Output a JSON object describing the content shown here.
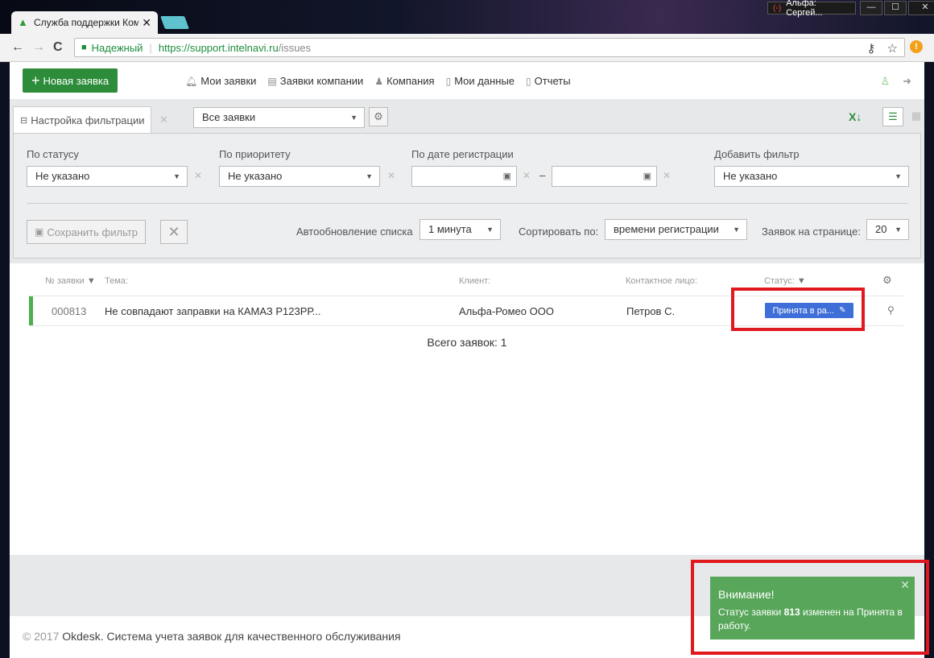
{
  "browser": {
    "tab_title": "Служба поддержки Ком",
    "tab_close": "✕",
    "profile_name": "Альфа: Сергей...",
    "window_min": "—",
    "window_max": "☐",
    "window_close": "✕",
    "secure_label": "Надежный",
    "url_host": "https://support.intelnavi.ru",
    "url_path": "/issues"
  },
  "header": {
    "new_ticket": "Новая заявка",
    "menu": [
      {
        "label": "Мои заявки",
        "icon": "bell-icon"
      },
      {
        "label": "Заявки компании",
        "icon": "briefcase-icon"
      },
      {
        "label": "Компания",
        "icon": "user-icon"
      },
      {
        "label": "Мои данные",
        "icon": "document-icon"
      },
      {
        "label": "Отчеты",
        "icon": "report-icon"
      }
    ]
  },
  "filterbar": {
    "tab_label": "Настройка фильтрации",
    "preset": "Все заявки"
  },
  "filters": {
    "status_label": "По статусу",
    "status_value": "Не указано",
    "priority_label": "По приоритету",
    "priority_value": "Не указано",
    "date_label": "По дате регистрации",
    "date_sep": "–",
    "add_label": "Добавить фильтр",
    "add_value": "Не указано",
    "save_button": "Сохранить фильтр",
    "autorefresh_label": "Автообновление списка",
    "autorefresh_value": "1 минута",
    "sort_label": "Сортировать по:",
    "sort_value": "времени регистрации",
    "per_page_label": "Заявок на странице:",
    "per_page_value": "20"
  },
  "table": {
    "columns": {
      "number": "№ заявки",
      "subject": "Тема:",
      "client": "Клиент:",
      "contact": "Контактное лицо:",
      "status": "Статус:"
    },
    "rows": [
      {
        "number": "000813",
        "subject": "Не совпадают заправки на КАМАЗ Р123РР...",
        "client": "Альфа-Ромео ООО",
        "contact": "Петров С.",
        "status": "Принята в ра..."
      }
    ],
    "total": "Всего заявок: 1"
  },
  "footer": {
    "copyright": "© 2017",
    "brand": "Okdesk",
    "text": ". Система учета заявок для качественного обслуживания"
  },
  "toast": {
    "title": "Внимание!",
    "msg_pre": "Статус заявки ",
    "msg_number": "813",
    "msg_post": " изменен на Принята в работу.",
    "close": "✕"
  },
  "colors": {
    "brand_green": "#2d8c3a",
    "status_blue": "#3e6fd8",
    "toast_green": "#58a65a",
    "highlight_red": "#e0191f"
  }
}
